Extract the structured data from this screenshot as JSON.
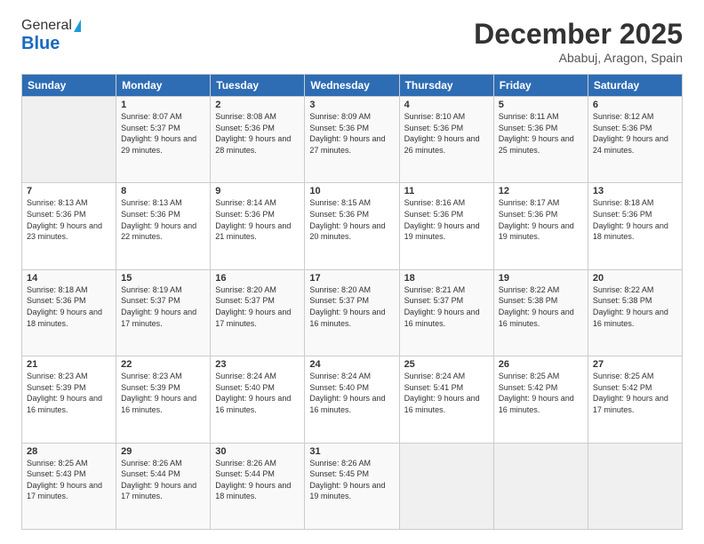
{
  "logo": {
    "general": "General",
    "blue": "Blue"
  },
  "header": {
    "month": "December 2025",
    "location": "Ababuj, Aragon, Spain"
  },
  "weekdays": [
    "Sunday",
    "Monday",
    "Tuesday",
    "Wednesday",
    "Thursday",
    "Friday",
    "Saturday"
  ],
  "weeks": [
    [
      {
        "day": "",
        "sunrise": "",
        "sunset": "",
        "daylight": "",
        "empty": true
      },
      {
        "day": "1",
        "sunrise": "Sunrise: 8:07 AM",
        "sunset": "Sunset: 5:37 PM",
        "daylight": "Daylight: 9 hours and 29 minutes."
      },
      {
        "day": "2",
        "sunrise": "Sunrise: 8:08 AM",
        "sunset": "Sunset: 5:36 PM",
        "daylight": "Daylight: 9 hours and 28 minutes."
      },
      {
        "day": "3",
        "sunrise": "Sunrise: 8:09 AM",
        "sunset": "Sunset: 5:36 PM",
        "daylight": "Daylight: 9 hours and 27 minutes."
      },
      {
        "day": "4",
        "sunrise": "Sunrise: 8:10 AM",
        "sunset": "Sunset: 5:36 PM",
        "daylight": "Daylight: 9 hours and 26 minutes."
      },
      {
        "day": "5",
        "sunrise": "Sunrise: 8:11 AM",
        "sunset": "Sunset: 5:36 PM",
        "daylight": "Daylight: 9 hours and 25 minutes."
      },
      {
        "day": "6",
        "sunrise": "Sunrise: 8:12 AM",
        "sunset": "Sunset: 5:36 PM",
        "daylight": "Daylight: 9 hours and 24 minutes."
      }
    ],
    [
      {
        "day": "7",
        "sunrise": "Sunrise: 8:13 AM",
        "sunset": "Sunset: 5:36 PM",
        "daylight": "Daylight: 9 hours and 23 minutes."
      },
      {
        "day": "8",
        "sunrise": "Sunrise: 8:13 AM",
        "sunset": "Sunset: 5:36 PM",
        "daylight": "Daylight: 9 hours and 22 minutes."
      },
      {
        "day": "9",
        "sunrise": "Sunrise: 8:14 AM",
        "sunset": "Sunset: 5:36 PM",
        "daylight": "Daylight: 9 hours and 21 minutes."
      },
      {
        "day": "10",
        "sunrise": "Sunrise: 8:15 AM",
        "sunset": "Sunset: 5:36 PM",
        "daylight": "Daylight: 9 hours and 20 minutes."
      },
      {
        "day": "11",
        "sunrise": "Sunrise: 8:16 AM",
        "sunset": "Sunset: 5:36 PM",
        "daylight": "Daylight: 9 hours and 19 minutes."
      },
      {
        "day": "12",
        "sunrise": "Sunrise: 8:17 AM",
        "sunset": "Sunset: 5:36 PM",
        "daylight": "Daylight: 9 hours and 19 minutes."
      },
      {
        "day": "13",
        "sunrise": "Sunrise: 8:18 AM",
        "sunset": "Sunset: 5:36 PM",
        "daylight": "Daylight: 9 hours and 18 minutes."
      }
    ],
    [
      {
        "day": "14",
        "sunrise": "Sunrise: 8:18 AM",
        "sunset": "Sunset: 5:36 PM",
        "daylight": "Daylight: 9 hours and 18 minutes."
      },
      {
        "day": "15",
        "sunrise": "Sunrise: 8:19 AM",
        "sunset": "Sunset: 5:37 PM",
        "daylight": "Daylight: 9 hours and 17 minutes."
      },
      {
        "day": "16",
        "sunrise": "Sunrise: 8:20 AM",
        "sunset": "Sunset: 5:37 PM",
        "daylight": "Daylight: 9 hours and 17 minutes."
      },
      {
        "day": "17",
        "sunrise": "Sunrise: 8:20 AM",
        "sunset": "Sunset: 5:37 PM",
        "daylight": "Daylight: 9 hours and 16 minutes."
      },
      {
        "day": "18",
        "sunrise": "Sunrise: 8:21 AM",
        "sunset": "Sunset: 5:37 PM",
        "daylight": "Daylight: 9 hours and 16 minutes."
      },
      {
        "day": "19",
        "sunrise": "Sunrise: 8:22 AM",
        "sunset": "Sunset: 5:38 PM",
        "daylight": "Daylight: 9 hours and 16 minutes."
      },
      {
        "day": "20",
        "sunrise": "Sunrise: 8:22 AM",
        "sunset": "Sunset: 5:38 PM",
        "daylight": "Daylight: 9 hours and 16 minutes."
      }
    ],
    [
      {
        "day": "21",
        "sunrise": "Sunrise: 8:23 AM",
        "sunset": "Sunset: 5:39 PM",
        "daylight": "Daylight: 9 hours and 16 minutes."
      },
      {
        "day": "22",
        "sunrise": "Sunrise: 8:23 AM",
        "sunset": "Sunset: 5:39 PM",
        "daylight": "Daylight: 9 hours and 16 minutes."
      },
      {
        "day": "23",
        "sunrise": "Sunrise: 8:24 AM",
        "sunset": "Sunset: 5:40 PM",
        "daylight": "Daylight: 9 hours and 16 minutes."
      },
      {
        "day": "24",
        "sunrise": "Sunrise: 8:24 AM",
        "sunset": "Sunset: 5:40 PM",
        "daylight": "Daylight: 9 hours and 16 minutes."
      },
      {
        "day": "25",
        "sunrise": "Sunrise: 8:24 AM",
        "sunset": "Sunset: 5:41 PM",
        "daylight": "Daylight: 9 hours and 16 minutes."
      },
      {
        "day": "26",
        "sunrise": "Sunrise: 8:25 AM",
        "sunset": "Sunset: 5:42 PM",
        "daylight": "Daylight: 9 hours and 16 minutes."
      },
      {
        "day": "27",
        "sunrise": "Sunrise: 8:25 AM",
        "sunset": "Sunset: 5:42 PM",
        "daylight": "Daylight: 9 hours and 17 minutes."
      }
    ],
    [
      {
        "day": "28",
        "sunrise": "Sunrise: 8:25 AM",
        "sunset": "Sunset: 5:43 PM",
        "daylight": "Daylight: 9 hours and 17 minutes."
      },
      {
        "day": "29",
        "sunrise": "Sunrise: 8:26 AM",
        "sunset": "Sunset: 5:44 PM",
        "daylight": "Daylight: 9 hours and 17 minutes."
      },
      {
        "day": "30",
        "sunrise": "Sunrise: 8:26 AM",
        "sunset": "Sunset: 5:44 PM",
        "daylight": "Daylight: 9 hours and 18 minutes."
      },
      {
        "day": "31",
        "sunrise": "Sunrise: 8:26 AM",
        "sunset": "Sunset: 5:45 PM",
        "daylight": "Daylight: 9 hours and 19 minutes."
      },
      {
        "day": "",
        "sunrise": "",
        "sunset": "",
        "daylight": "",
        "empty": true
      },
      {
        "day": "",
        "sunrise": "",
        "sunset": "",
        "daylight": "",
        "empty": true
      },
      {
        "day": "",
        "sunrise": "",
        "sunset": "",
        "daylight": "",
        "empty": true
      }
    ]
  ]
}
